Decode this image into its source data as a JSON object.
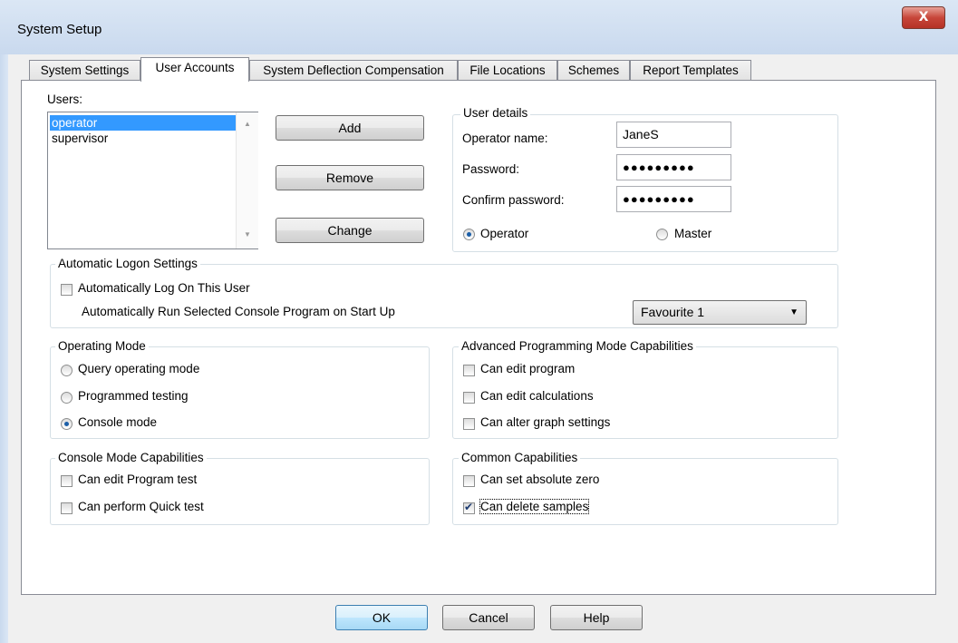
{
  "window": {
    "title": "System Setup",
    "close_glyph": "X"
  },
  "tabs": [
    "System Settings",
    "User Accounts",
    "System Deflection Compensation",
    "File Locations",
    "Schemes",
    "Report Templates"
  ],
  "active_tab": "User Accounts",
  "users": {
    "label": "Users:",
    "items": [
      "operator",
      "supervisor"
    ],
    "selected": "operator"
  },
  "user_buttons": {
    "add": "Add",
    "remove": "Remove",
    "change": "Change"
  },
  "user_details": {
    "legend": "User details",
    "operator_name_label": "Operator name:",
    "operator_name_value": "JaneS",
    "password_label": "Password:",
    "password_value": "●●●●●●●●●",
    "confirm_label": "Confirm password:",
    "confirm_value": "●●●●●●●●●",
    "role_operator": "Operator",
    "role_master": "Master",
    "selected_role": "Operator"
  },
  "auto_logon": {
    "legend": "Automatic Logon Settings",
    "auto_log_on_label": "Automatically Log On This User",
    "auto_log_on_checked": false,
    "auto_run_label": "Automatically Run Selected Console Program on Start Up",
    "program_selected": "Favourite 1"
  },
  "operating_mode": {
    "legend": "Operating Mode",
    "options": [
      "Query operating mode",
      "Programmed testing",
      "Console mode"
    ],
    "selected": "Console mode"
  },
  "advanced": {
    "legend": "Advanced Programming Mode Capabilities",
    "items": [
      {
        "label": "Can edit program",
        "checked": false
      },
      {
        "label": "Can edit calculations",
        "checked": false
      },
      {
        "label": "Can alter graph settings",
        "checked": false
      }
    ]
  },
  "console_caps": {
    "legend": "Console Mode Capabilities",
    "items": [
      {
        "label": "Can edit Program test",
        "checked": false
      },
      {
        "label": "Can perform Quick test",
        "checked": false
      }
    ]
  },
  "common_caps": {
    "legend": "Common Capabilities",
    "items": [
      {
        "label": "Can set absolute zero",
        "checked": false
      },
      {
        "label": "Can delete samples",
        "checked": true
      }
    ]
  },
  "footer": {
    "ok": "OK",
    "cancel": "Cancel",
    "help": "Help"
  }
}
